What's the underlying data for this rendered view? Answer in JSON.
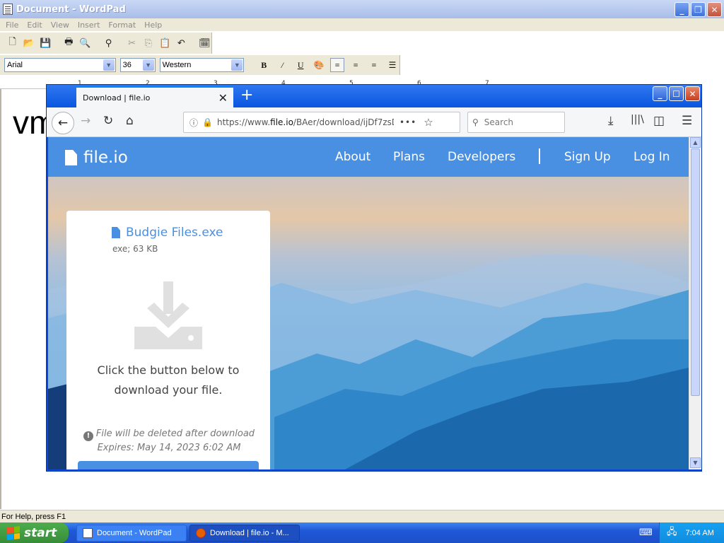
{
  "wordpad": {
    "title": "Document - WordPad",
    "menu": [
      "File",
      "Edit",
      "View",
      "Insert",
      "Format",
      "Help"
    ],
    "font_name": "Arial",
    "font_size": "36",
    "script": "Western",
    "ruler_ticks": [
      "1",
      "2",
      "3",
      "4",
      "5",
      "6",
      "7"
    ],
    "doc_text": "vm",
    "status": "For Help, press F1"
  },
  "browser": {
    "tab_title": "Download | file.io",
    "url_prefix": "https://www.",
    "url_domain": "file.io",
    "url_path": "/BAer/download/ijDf7zsD",
    "search_placeholder": "Search"
  },
  "site": {
    "logo": "file.io",
    "nav": [
      "About",
      "Plans",
      "Developers",
      "Sign Up",
      "Log In"
    ],
    "file_name": "Budgie Files.exe",
    "file_meta": "exe; 63 KB",
    "instructions": "Click the button below to download your file.",
    "warning": "File will be deleted after download",
    "expires": "Expires: May 14, 2023 6:02 AM",
    "accent": "#4a90e2"
  },
  "taskbar": {
    "start": "start",
    "tasks": [
      "Document - WordPad",
      "Download | file.io - M..."
    ],
    "clock": "7:04 AM"
  }
}
